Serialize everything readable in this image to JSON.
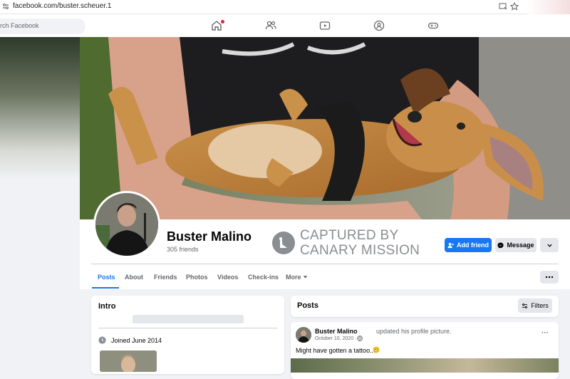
{
  "browser": {
    "url": "facebook.com/buster.scheuer.1"
  },
  "nav": {
    "search_placeholder": "rch Facebook"
  },
  "profile": {
    "name": "Buster Malino",
    "friends": "305 friends",
    "watermark_line1": "CAPTURED BY",
    "watermark_line2": "CANARY MISSION",
    "add_friend": "Add friend",
    "message": "Message"
  },
  "tabs": [
    {
      "label": "Posts"
    },
    {
      "label": "About"
    },
    {
      "label": "Friends"
    },
    {
      "label": "Photos"
    },
    {
      "label": "Videos"
    },
    {
      "label": "Check-ins"
    },
    {
      "label": "More"
    }
  ],
  "intro": {
    "title": "Intro",
    "joined": "Joined June 2014"
  },
  "posts": {
    "title": "Posts",
    "filters": "Filters",
    "item": {
      "author": "Buster Malino",
      "action": "updated his profile picture.",
      "date": "October 10, 2020 ·",
      "text": "Might have gotten a tattoo.... "
    }
  },
  "colors": {
    "accent": "#1877f2",
    "notification": "#e41e3f"
  }
}
